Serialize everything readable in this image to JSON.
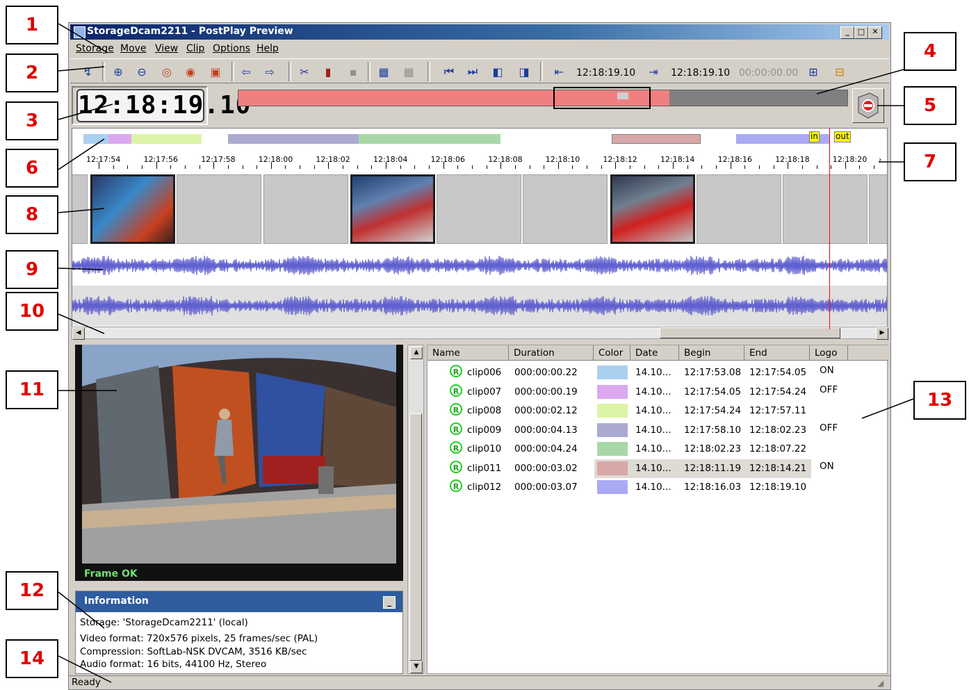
{
  "window": {
    "title": "StorageDcam2211 - PostPlay Preview"
  },
  "callouts": [
    "1",
    "2",
    "3",
    "4",
    "5",
    "6",
    "7",
    "8",
    "9",
    "10",
    "11",
    "12",
    "13",
    "14"
  ],
  "menu": [
    "Storage",
    "Move",
    "View",
    "Clip",
    "Options",
    "Help"
  ],
  "toolbar": {
    "tc_in": "12:18:19.10",
    "tc_out": "12:18:19.10",
    "tc_dur": "00:00:00.00"
  },
  "clock": "12:18:19.10",
  "timeline": {
    "ticks": [
      "12:17:54",
      "12:17:56",
      "12:17:58",
      "12:18:00",
      "12:18:02",
      "12:18:04",
      "12:18:06",
      "12:18:08",
      "12:18:10",
      "12:18:12",
      "12:18:14",
      "12:18:16",
      "12:18:18",
      "12:18:20"
    ],
    "in_label": "in",
    "out_label": "out"
  },
  "preview": {
    "status": "Frame OK"
  },
  "info": {
    "title": "Information",
    "lines": [
      "Storage: 'StorageDcam2211' (local)",
      "Video format: 720x576 pixels, 25 frames/sec (PAL)",
      "Compression: SoftLab-NSK DVCAM, 3516 KB/sec",
      "Audio format: 16 bits, 44100 Hz, Stereo"
    ]
  },
  "clip_table": {
    "columns": [
      "Name",
      "Duration",
      "Color",
      "Date",
      "Begin",
      "End",
      "Logo"
    ],
    "rows": [
      {
        "name": "clip006",
        "duration": "000:00:00.22",
        "color": "#aad0f0",
        "date": "14.10...",
        "begin": "12:17:53.08",
        "end": "12:17:54.05",
        "logo": "ON"
      },
      {
        "name": "clip007",
        "duration": "000:00:00.19",
        "color": "#dca8f0",
        "date": "14.10...",
        "begin": "12:17:54.05",
        "end": "12:17:54.24",
        "logo": "OFF"
      },
      {
        "name": "clip008",
        "duration": "000:00:02.12",
        "color": "#dcf4a8",
        "date": "14.10...",
        "begin": "12:17:54.24",
        "end": "12:17:57.11",
        "logo": ""
      },
      {
        "name": "clip009",
        "duration": "000:00:04.13",
        "color": "#aaaad0",
        "date": "14.10...",
        "begin": "12:17:58.10",
        "end": "12:18:02.23",
        "logo": "OFF"
      },
      {
        "name": "clip010",
        "duration": "000:00:04.24",
        "color": "#a8d8a8",
        "date": "14.10...",
        "begin": "12:18:02.23",
        "end": "12:18:07.22",
        "logo": ""
      },
      {
        "name": "clip011",
        "duration": "000:00:03.02",
        "color": "#d8a8a8",
        "date": "14.10...",
        "begin": "12:18:11.19",
        "end": "12:18:14.21",
        "logo": "ON"
      },
      {
        "name": "clip012",
        "duration": "000:00:03.07",
        "color": "#aaaaf4",
        "date": "14.10...",
        "begin": "12:18:16.03",
        "end": "12:18:19.10",
        "logo": ""
      }
    ],
    "selected_row": 5,
    "logo_icon": "r-circle-icon"
  },
  "status": "Ready"
}
